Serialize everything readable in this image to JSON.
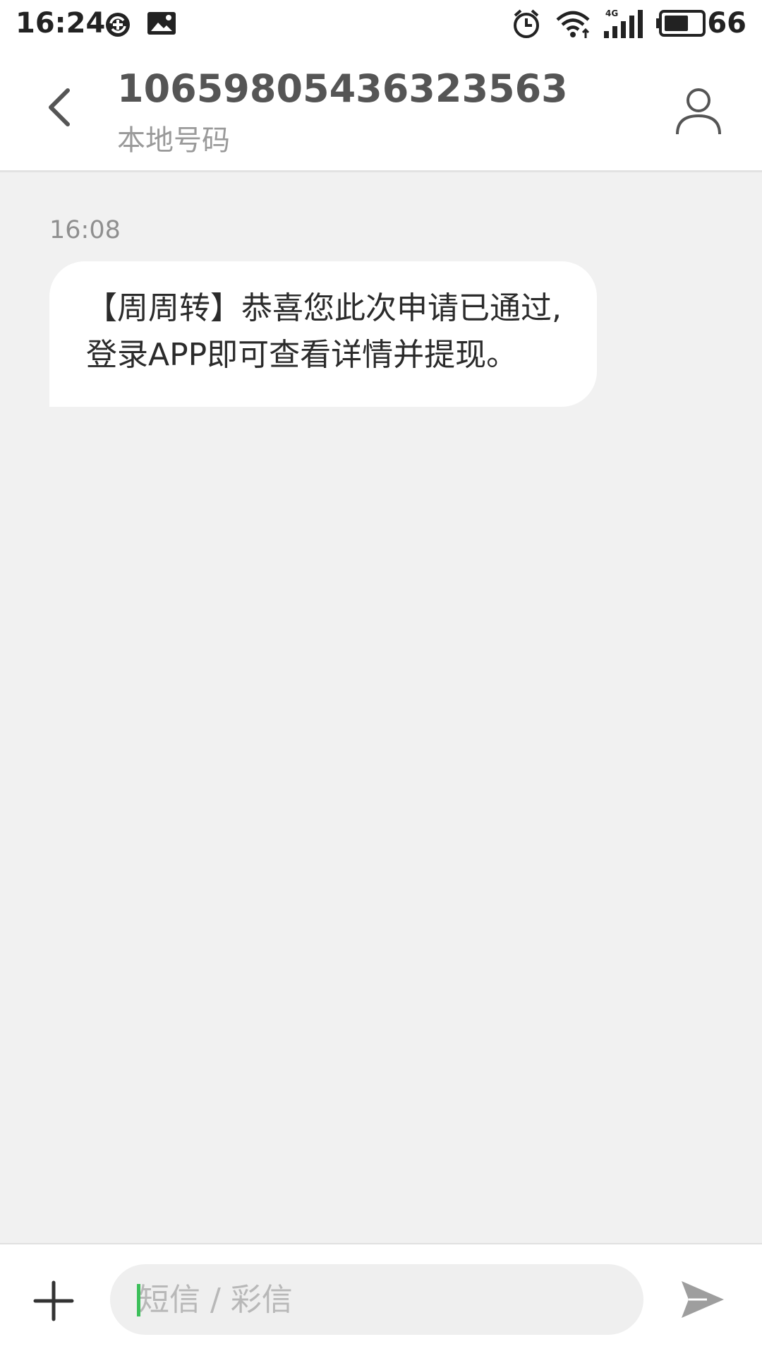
{
  "status_bar": {
    "time": "16:24",
    "battery_level": "66",
    "network_type": "4G",
    "icons": [
      "sync-icon",
      "image-icon",
      "alarm-icon",
      "wifi-icon",
      "signal-icon",
      "battery-icon"
    ]
  },
  "header": {
    "contact_number": "10659805436323563",
    "contact_subtitle": "本地号码",
    "back_icon": "chevron-left-icon",
    "contact_icon": "person-icon"
  },
  "conversation": {
    "messages": [
      {
        "time": "16:08",
        "text": "【周周转】恭喜您此次申请已通过,登录APP即可查看详情并提现。",
        "direction": "incoming"
      }
    ]
  },
  "input_bar": {
    "placeholder": "短信 / 彩信",
    "value": "",
    "add_icon": "plus-icon",
    "send_icon": "send-icon"
  },
  "colors": {
    "background": "#f1f1f1",
    "bubble": "#ffffff",
    "caret": "#3cbf5a",
    "header_text": "#555555",
    "subtitle_text": "#9a9a9a"
  }
}
